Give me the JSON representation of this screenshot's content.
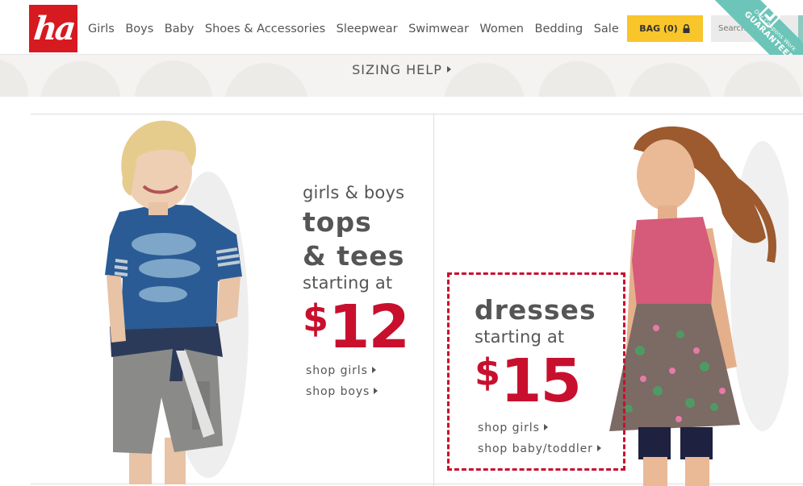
{
  "header": {
    "logo_text": "ha",
    "nav": [
      "Girls",
      "Boys",
      "Baby",
      "Shoes & Accessories",
      "Sleepwear",
      "Swimwear",
      "Women",
      "Bedding",
      "Sale"
    ],
    "bag_label": "BAG (0)",
    "search_placeholder": "Search",
    "coupon_ribbon": {
      "line1": "Our Coupons Work",
      "line2": "GUARANTEED"
    }
  },
  "sizing": {
    "label": "SIZING HELP"
  },
  "promo_left": {
    "line1": "girls & boys",
    "line2": "tops",
    "line3": "& tees",
    "line4": "starting at",
    "currency": "$",
    "price": "12",
    "links": [
      "shop girls",
      "shop boys"
    ]
  },
  "promo_right": {
    "line1": "dresses",
    "line2": "starting at",
    "currency": "$",
    "price": "15",
    "links": [
      "shop girls",
      "shop baby/toddler"
    ]
  },
  "colors": {
    "brand_red": "#d71920",
    "price_red": "#c8102e",
    "bag_yellow": "#f8c52b",
    "ribbon_teal": "#6cc5b8"
  }
}
